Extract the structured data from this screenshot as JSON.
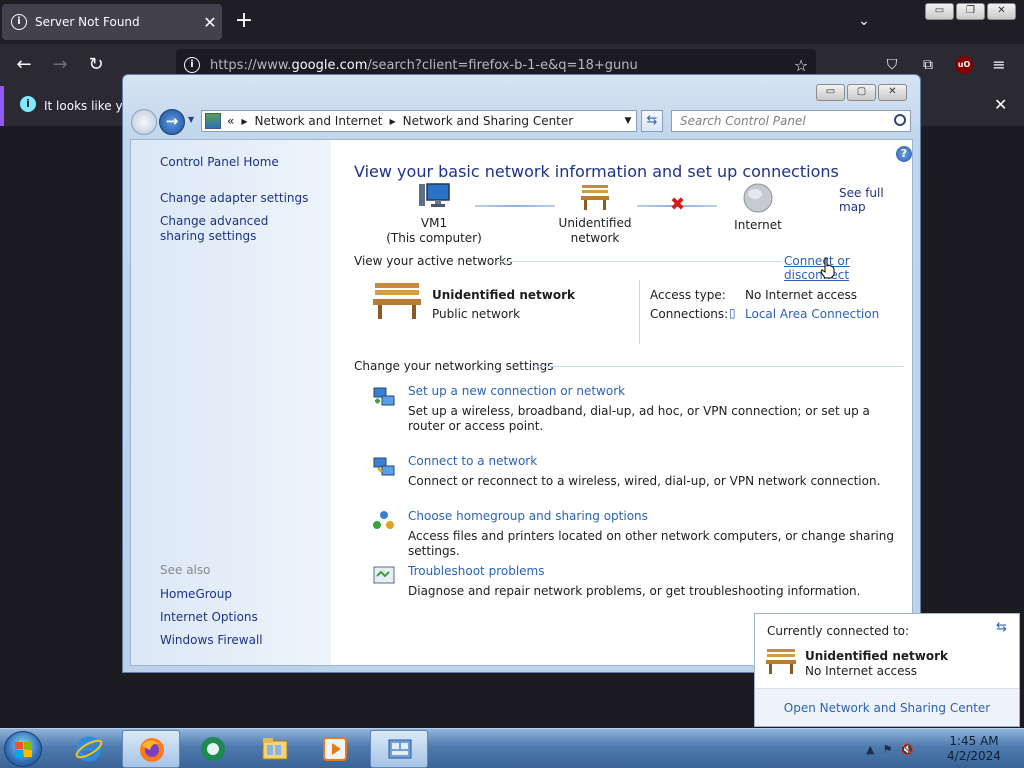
{
  "firefox": {
    "tab_title": "Server Not Found",
    "url_prefix": "https://www.",
    "url_domain": "google.com",
    "url_rest": "/search?client=firefox-b-1-e&q=18+gunu",
    "notice_text": "It looks like you",
    "icons": [
      "info-icon",
      "close-icon",
      "plus-icon",
      "chevron-down-icon",
      "back-arrow-icon",
      "forward-arrow-icon",
      "reload-icon",
      "star-icon",
      "pocket-icon",
      "extensions-icon",
      "ublock-icon",
      "menu-icon"
    ]
  },
  "control_panel": {
    "breadcrumb": {
      "prefix": "«",
      "items": [
        "Network and Internet",
        "Network and Sharing Center"
      ]
    },
    "search_placeholder": "Search Control Panel",
    "sidebar": {
      "links": [
        "Control Panel Home",
        "Change adapter settings",
        "Change advanced sharing settings"
      ],
      "see_also_label": "See also",
      "see_also": [
        "HomeGroup",
        "Internet Options",
        "Windows Firewall"
      ]
    },
    "title": "View your basic network information and set up connections",
    "see_full_map": "See full map",
    "network_map": {
      "computer_name": "VM1",
      "computer_sub": "(This computer)",
      "network_label": "Unidentified network",
      "internet_label": "Internet"
    },
    "active_networks_label": "View your active networks",
    "connect_or_disconnect": "Connect or disconnect",
    "active_network": {
      "name": "Unidentified network",
      "category": "Public network",
      "access_type_label": "Access type:",
      "access_type_value": "No Internet access",
      "connections_label": "Connections:",
      "connections_value": "Local Area Connection"
    },
    "change_settings_label": "Change your networking settings",
    "tasks": [
      {
        "title": "Set up a new connection or network",
        "desc": "Set up a wireless, broadband, dial-up, ad hoc, or VPN connection; or set up a router or access point.",
        "icon": "new-connection-icon"
      },
      {
        "title": "Connect to a network",
        "desc": "Connect or reconnect to a wireless, wired, dial-up, or VPN network connection.",
        "icon": "connect-network-icon"
      },
      {
        "title": "Choose homegroup and sharing options",
        "desc": "Access files and printers located on other network computers, or change sharing settings.",
        "icon": "homegroup-icon"
      },
      {
        "title": "Troubleshoot problems",
        "desc": "Diagnose and repair network problems, or get troubleshooting information.",
        "icon": "troubleshoot-icon"
      }
    ]
  },
  "popup": {
    "header": "Currently connected to:",
    "network_name": "Unidentified network",
    "network_status": "No Internet access",
    "footer_link": "Open Network and Sharing Center"
  },
  "taskbar": {
    "items": [
      "internet-explorer-icon",
      "firefox-icon",
      "media-center-icon",
      "windows-explorer-icon",
      "media-player-icon",
      "control-panel-icon"
    ],
    "time": "1:45 AM",
    "date": "4/2/2024"
  }
}
